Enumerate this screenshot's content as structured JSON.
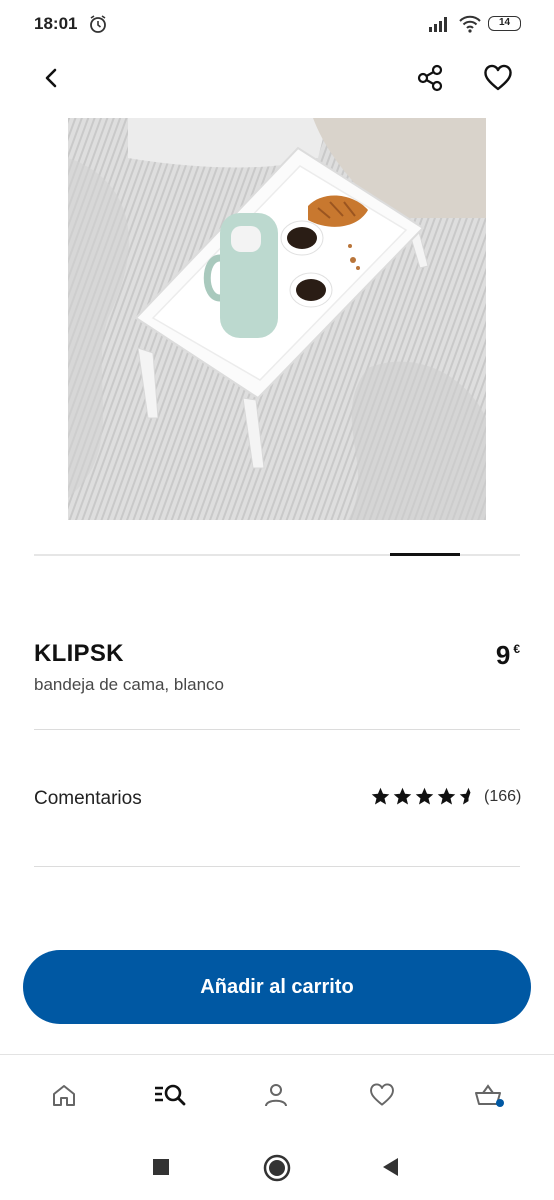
{
  "status_bar": {
    "time": "18:01",
    "battery": "14"
  },
  "product": {
    "name": "KLIPSK",
    "description": "bandeja de cama, blanco",
    "price": "9",
    "currency": "€",
    "carousel": {
      "active_index": 5,
      "total": 6
    }
  },
  "reviews": {
    "label": "Comentarios",
    "rating": 4.5,
    "count": "(166)"
  },
  "cta": {
    "label": "Añadir al carrito"
  },
  "tabs": [
    {
      "icon": "home-icon",
      "active": false
    },
    {
      "icon": "search-icon",
      "active": true
    },
    {
      "icon": "profile-icon",
      "active": false
    },
    {
      "icon": "heart-icon",
      "active": false
    },
    {
      "icon": "cart-icon",
      "active": false
    }
  ],
  "colors": {
    "brand_blue": "#0058a3",
    "text": "#111111"
  }
}
